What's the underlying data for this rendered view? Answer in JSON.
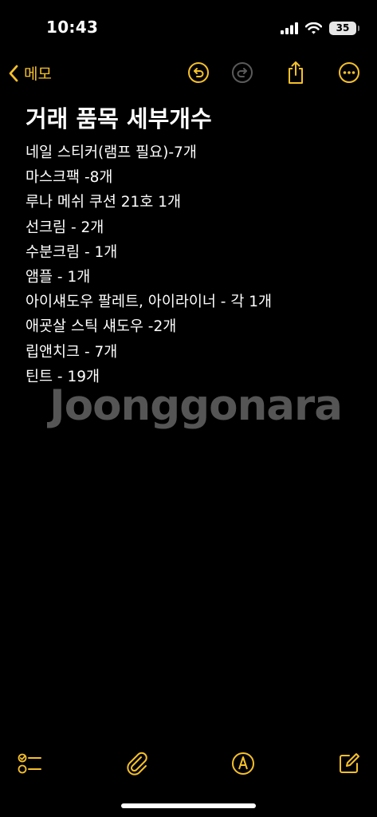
{
  "status_bar": {
    "time": "10:43",
    "battery": "35"
  },
  "nav": {
    "back_label": "메모",
    "icons": [
      "chevron-left-icon",
      "undo-icon",
      "redo-icon",
      "share-icon",
      "more-icon"
    ]
  },
  "note": {
    "title": "거래 품목 세부개수",
    "lines": [
      "네일 스티커(램프 필요)-7개",
      "마스크팩 -8개",
      "루나 메쉬 쿠션 21호 1개",
      "선크림 - 2개",
      "수분크림 - 1개",
      "앰플 - 1개",
      "아이섀도우 팔레트, 아이라이너 - 각 1개",
      "애굣살 스틱 섀도우 -2개",
      "립앤치크 - 7개",
      "틴트 - 19개"
    ]
  },
  "watermark": "Joonggonara",
  "toolbar": {
    "icons": [
      "checklist-icon",
      "paperclip-icon",
      "markup-pen-icon",
      "compose-icon"
    ]
  },
  "colors": {
    "accent": "#f5c02a",
    "background": "#000000",
    "text": "#ffffff",
    "watermark": "#555555"
  }
}
